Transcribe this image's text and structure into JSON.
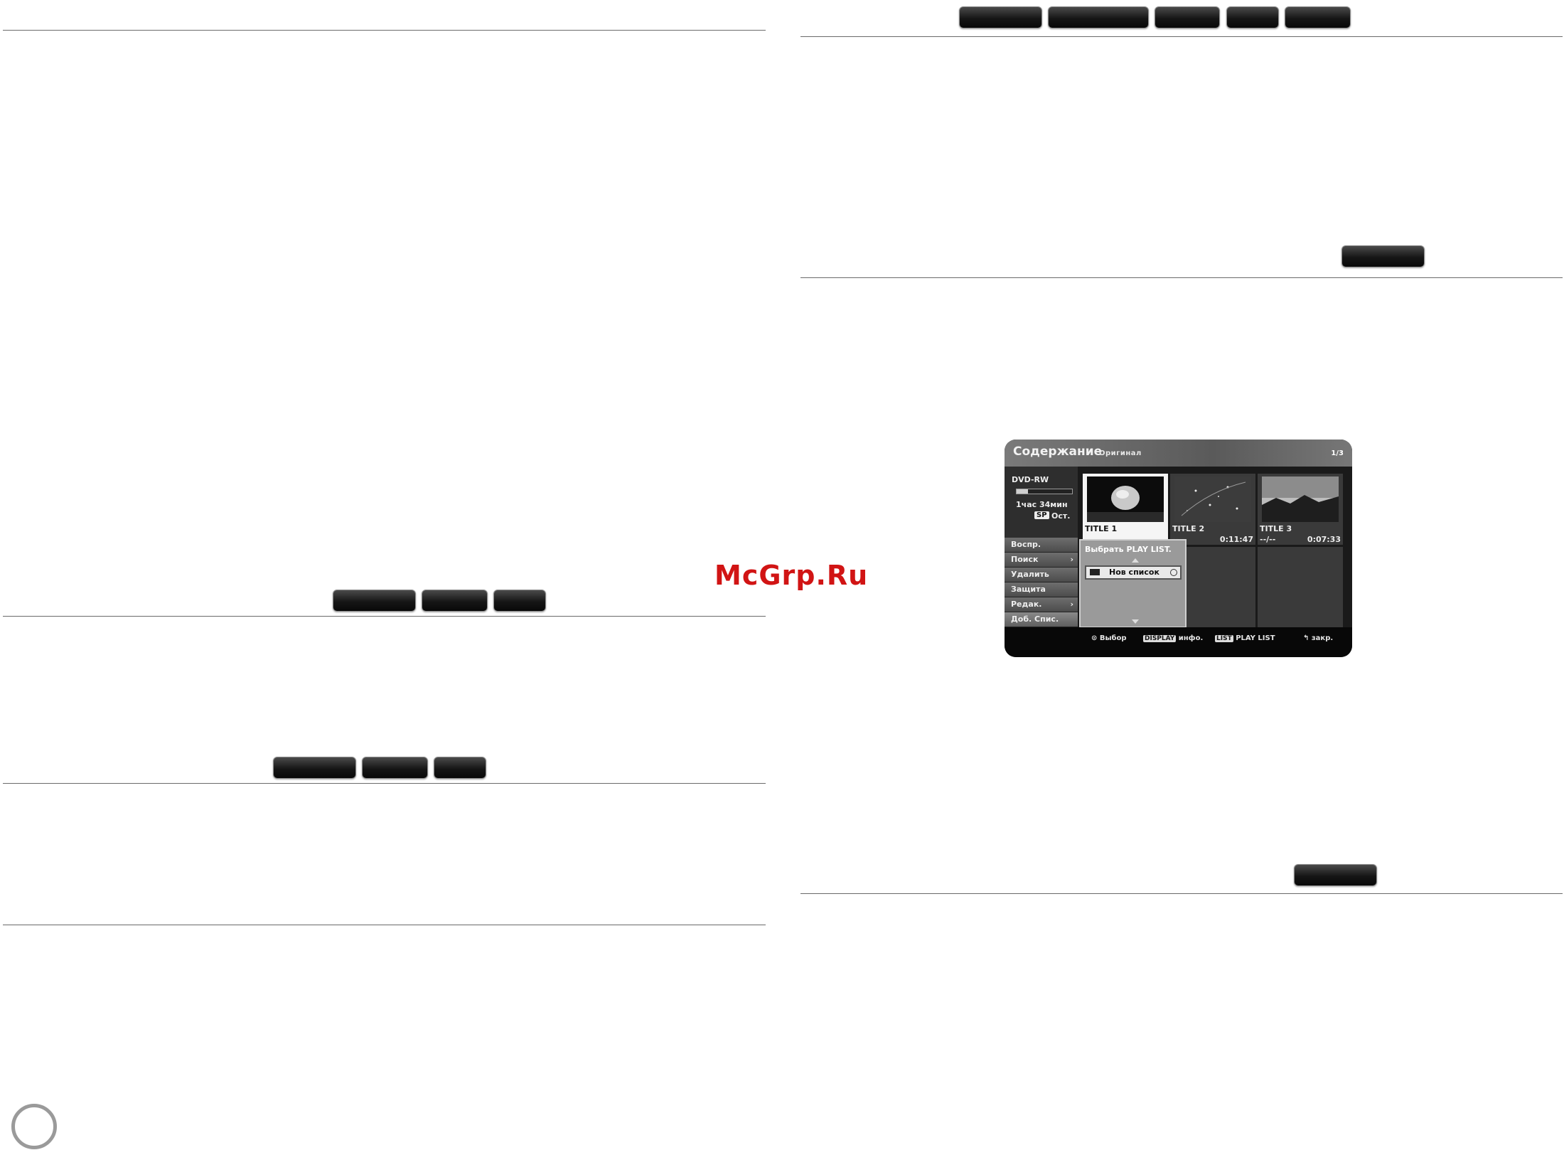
{
  "watermark": "McGrp.Ru",
  "osd": {
    "title": "Содержание",
    "subtitle": "Оригинал",
    "page": "1/3",
    "disc": "DVD-RW",
    "remaining_time": "1час 34мин",
    "record_mode": "SP",
    "remaining_label": "Ост.",
    "disc_usage_fraction": 0.2,
    "menu": [
      "Воспр.",
      "Поиск",
      "Удалить",
      "Защита",
      "Редак.",
      "Доб. Спис."
    ],
    "titles": [
      {
        "label": "TITLE 1",
        "dash": "",
        "time": ""
      },
      {
        "label": "TITLE 2",
        "dash": "--",
        "time": "0:11:47"
      },
      {
        "label": "TITLE 3",
        "dash": "--/--",
        "time": "0:07:33"
      }
    ],
    "popup": {
      "title": "Выбрать PLAY LIST.",
      "button": "Нов список"
    },
    "footer": {
      "select": "Выбор",
      "display_key": "DISPLAY",
      "display_label": "инфо.",
      "list_key": "LIST",
      "list_label": "PLAY LIST",
      "close": "закр."
    }
  }
}
